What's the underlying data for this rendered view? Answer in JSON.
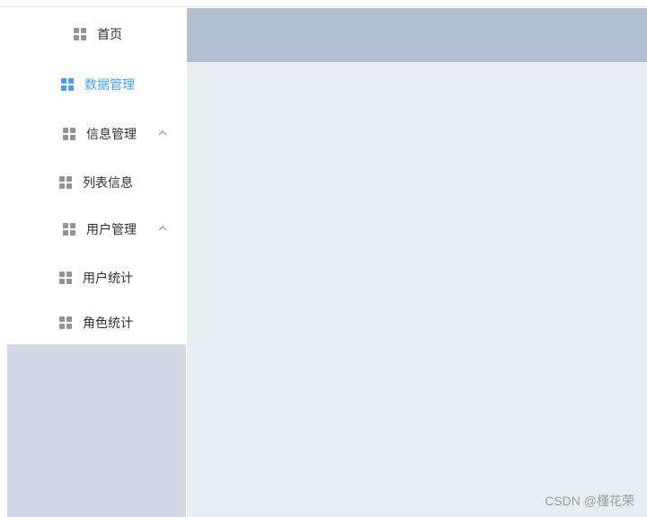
{
  "menu": {
    "items": [
      {
        "label": "首页",
        "icon": "grid-icon",
        "active": false,
        "expandable": false
      },
      {
        "label": "数据管理",
        "icon": "grid-icon",
        "active": true,
        "expandable": false
      },
      {
        "label": "信息管理",
        "icon": "grid-icon",
        "active": false,
        "expandable": true
      },
      {
        "label": "列表信息",
        "icon": "grid-icon",
        "active": false,
        "expandable": false
      },
      {
        "label": "用户管理",
        "icon": "grid-icon",
        "active": false,
        "expandable": true
      },
      {
        "label": "用户统计",
        "icon": "grid-icon",
        "active": false,
        "expandable": false
      },
      {
        "label": "角色统计",
        "icon": "grid-icon",
        "active": false,
        "expandable": false
      }
    ]
  },
  "colors": {
    "active": "#409eff",
    "sidebar_bg": "#d3d9e4",
    "header_bg": "#b3c0d1",
    "main_bg": "#e8edf2"
  },
  "watermark": "CSDN @槿花荣"
}
